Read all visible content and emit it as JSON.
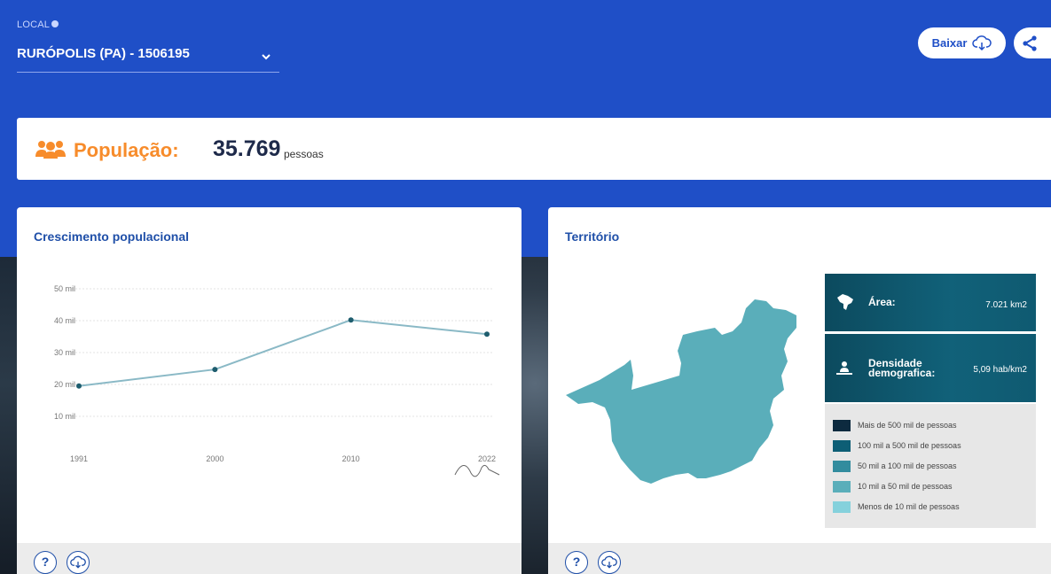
{
  "header": {
    "local_label": "LOCAL",
    "local_value": "RURÓPOLIS (PA) - 1506195",
    "download_label": "Baixar"
  },
  "population": {
    "label": "População:",
    "value": "35.769",
    "unit": "pessoas"
  },
  "growth_card": {
    "title": "Crescimento populacional"
  },
  "chart_data": {
    "type": "line",
    "x": [
      "1991",
      "2000",
      "2010",
      "2022"
    ],
    "series": [
      {
        "values": [
          19500,
          24700,
          40200,
          35769
        ]
      }
    ],
    "y_ticks": [
      "50 mil",
      "40 mil",
      "30 mil",
      "20 mil",
      "10 mil"
    ],
    "ylim": [
      0,
      50000
    ],
    "grid": true,
    "color": "#8ab9c6"
  },
  "territory_card": {
    "title": "Território",
    "area_label": "Área:",
    "area_value": "7.021 km2",
    "density_label_1": "Densidade",
    "density_label_2": "demografica:",
    "density_value": "5,09 hab/km2",
    "legend": [
      {
        "label": "Mais de 500 mil de pessoas",
        "color": "#0d2a3f"
      },
      {
        "label": "100 mil a 500 mil de pessoas",
        "color": "#0d5e75"
      },
      {
        "label": "50 mil a 100 mil de pessoas",
        "color": "#328c9e"
      },
      {
        "label": "10 mil a 50 mil de pessoas",
        "color": "#5aaeba"
      },
      {
        "label": "Menos de 10 mil de pessoas",
        "color": "#85d1dc"
      }
    ],
    "map_fill": "#5aaeba"
  },
  "icons": {
    "help": "?",
    "download": "cloud-download-icon"
  }
}
